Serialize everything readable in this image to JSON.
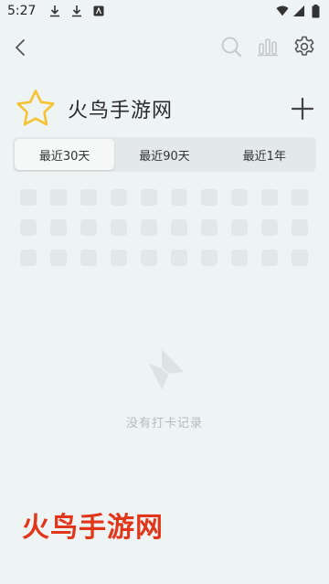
{
  "status_bar": {
    "time": "5:27",
    "icons": [
      "download-icon",
      "download-icon",
      "app-icon",
      "wifi-icon",
      "signal-icon",
      "battery-icon"
    ]
  },
  "toolbar": {
    "back_icon": "back-arrow-icon",
    "actions": [
      "search-icon",
      "stats-icon",
      "settings-icon"
    ]
  },
  "habit": {
    "icon": "star-icon",
    "title": "火鸟手游网",
    "add_icon": "plus-icon"
  },
  "range_tabs": [
    {
      "label": "最近30天",
      "selected": true
    },
    {
      "label": "最近90天",
      "selected": false
    },
    {
      "label": "最近1年",
      "selected": false
    }
  ],
  "empty_state": {
    "icon": "paper-plane-icon",
    "text": "没有打卡记录"
  },
  "watermark": "火鸟手游网",
  "colors": {
    "background": "#eef3f3",
    "star": "#f5c232",
    "watermark": "#e2361a",
    "cell": "#e2e8e8"
  }
}
